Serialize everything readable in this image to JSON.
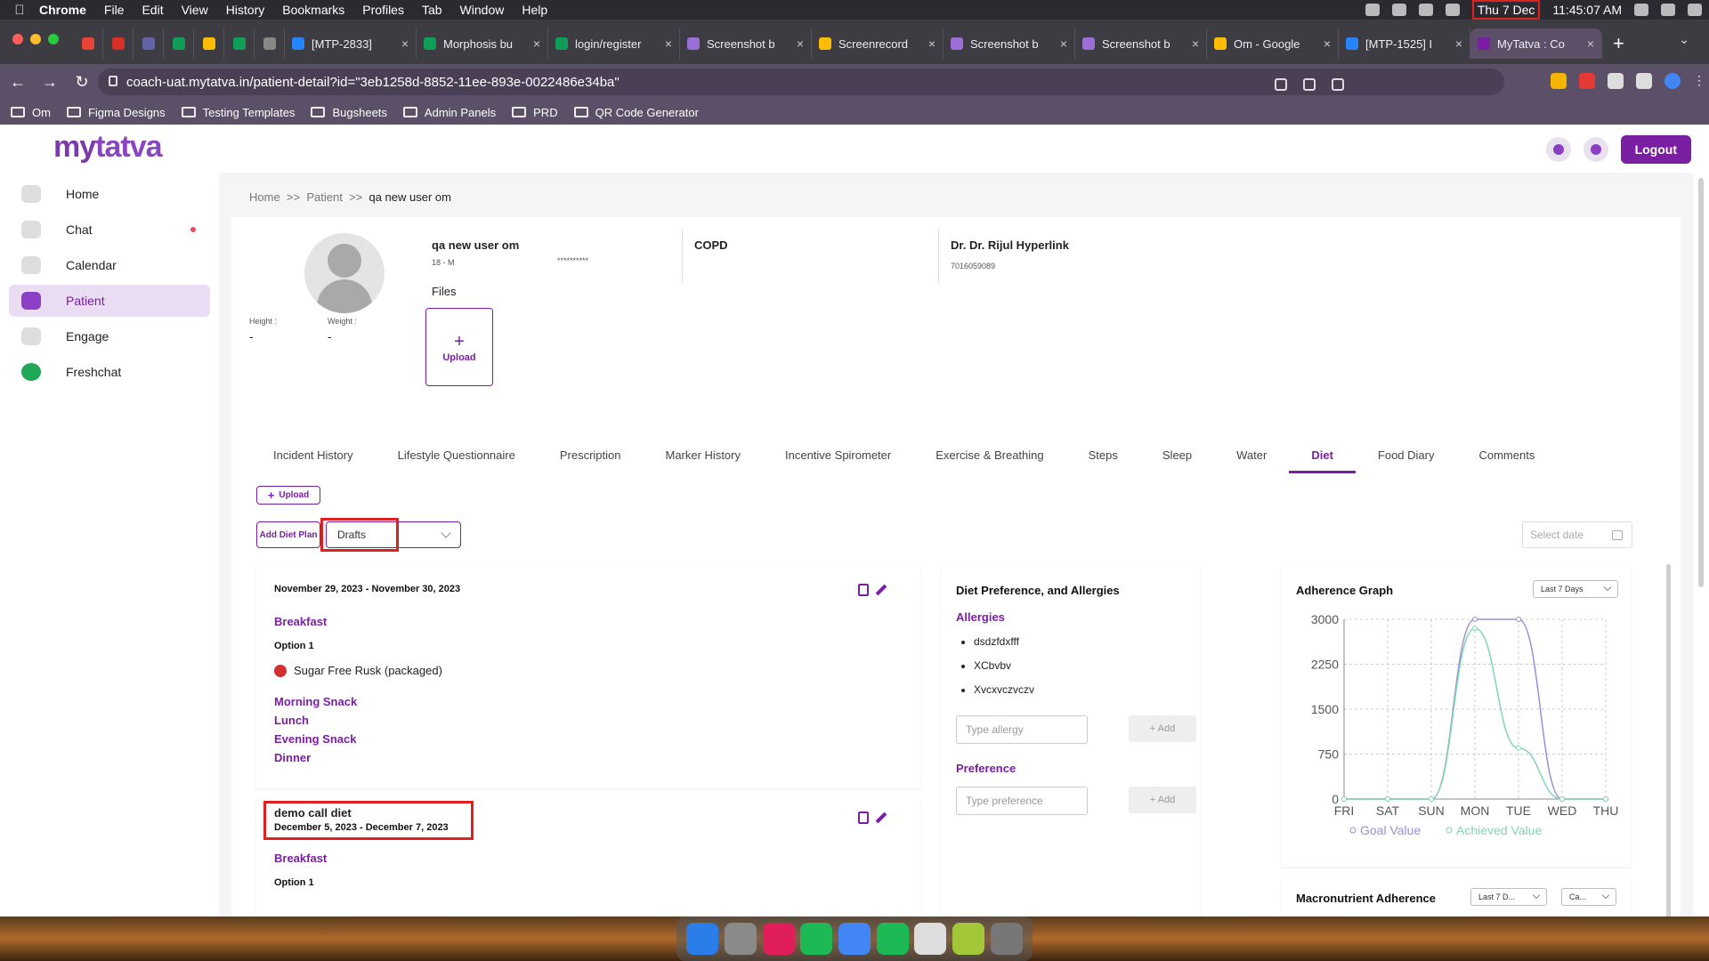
{
  "menubar": {
    "app": "Chrome",
    "items": [
      "File",
      "Edit",
      "View",
      "History",
      "Bookmarks",
      "Profiles",
      "Tab",
      "Window",
      "Help"
    ],
    "date": "Thu 7 Dec",
    "time": "11:45:07 AM"
  },
  "tabs": [
    {
      "label": "",
      "pinned": true,
      "color": "#e84335"
    },
    {
      "label": "",
      "pinned": true,
      "color": "#d93025"
    },
    {
      "label": "",
      "pinned": true,
      "color": "#6264a7"
    },
    {
      "label": "",
      "pinned": true,
      "color": "#0f9d58"
    },
    {
      "label": "",
      "pinned": true,
      "color": "#fbbc04"
    },
    {
      "label": "",
      "pinned": true,
      "color": "#0f9d58"
    },
    {
      "label": "",
      "pinned": true,
      "color": "#888888"
    },
    {
      "label": "[MTP-2833]",
      "color": "#2684ff"
    },
    {
      "label": "Morphosis bu",
      "color": "#0f9d58"
    },
    {
      "label": "login/register",
      "color": "#0f9d58"
    },
    {
      "label": "Screenshot b",
      "color": "#9c6fd6"
    },
    {
      "label": "Screenrecord",
      "color": "#fbbc04"
    },
    {
      "label": "Screenshot b",
      "color": "#9c6fd6"
    },
    {
      "label": "Screenshot b",
      "color": "#9c6fd6"
    },
    {
      "label": "Om - Google",
      "color": "#fbbc04"
    },
    {
      "label": "[MTP-1525] I",
      "color": "#2684ff"
    },
    {
      "label": "MyTatva : Co",
      "color": "#7a1fa2",
      "active": true
    }
  ],
  "url": "coach-uat.mytatva.in/patient-detail?id=\"3eb1258d-8852-11ee-893e-0022486e34ba\"",
  "bookmarks": [
    "Om",
    "Figma Designs",
    "Testing Templates",
    "Bugsheets",
    "Admin Panels",
    "PRD",
    "QR Code Generator"
  ],
  "brand": {
    "my": "my",
    "tatva": "tatva"
  },
  "header": {
    "logout": "Logout"
  },
  "sidebar": [
    {
      "label": "Home",
      "icon": "home-icon"
    },
    {
      "label": "Chat",
      "icon": "chat-icon",
      "dot": true
    },
    {
      "label": "Calendar",
      "icon": "calendar-icon"
    },
    {
      "label": "Patient",
      "icon": "patient-icon",
      "active": true
    },
    {
      "label": "Engage",
      "icon": "engage-icon"
    },
    {
      "label": "Freshchat",
      "icon": "freshchat-icon"
    }
  ],
  "breadcrumb": {
    "home": "Home",
    "sep": ">>",
    "patient": "Patient",
    "current": "qa new user om"
  },
  "patient": {
    "name": "qa new user om",
    "age_gender": "18 - M",
    "masked": "**********",
    "condition": "COPD",
    "doctor": "Dr. Dr. Rijul Hyperlink",
    "phone": "7016059089",
    "height_label": "Height :",
    "height": "-",
    "weight_label": "Weight :",
    "weight": "-",
    "files": "Files",
    "upload": "Upload"
  },
  "patient_tabs": [
    "Incident History",
    "Lifestyle Questionnaire",
    "Prescription",
    "Marker History",
    "Incentive Spirometer",
    "Exercise & Breathing",
    "Steps",
    "Sleep",
    "Water",
    "Diet",
    "Food Diary",
    "Comments"
  ],
  "active_tab": "Diet",
  "diet": {
    "upload": "Upload",
    "add_plan": "Add Diet Plan",
    "filter": "Drafts",
    "select_date": "Select date",
    "plans": [
      {
        "title": "",
        "dates": "November 29, 2023 - November 30, 2023",
        "meal1": "Breakfast",
        "option": "Option 1",
        "food": "Sugar Free Rusk (packaged)",
        "meals": [
          "Morning Snack",
          "Lunch",
          "Evening Snack",
          "Dinner"
        ]
      },
      {
        "title": "demo call diet",
        "dates": "December 5, 2023 - December 7, 2023",
        "meal1": "Breakfast",
        "option": "Option 1"
      }
    ]
  },
  "preferences": {
    "title": "Diet Preference, and Allergies",
    "allergies_title": "Allergies",
    "allergies": [
      "dsdzfdxfff",
      "XCbvbv",
      "Xvcxvczvczv"
    ],
    "allergy_placeholder": "Type allergy",
    "add": "+ Add",
    "preference_title": "Preference",
    "preference_placeholder": "Type preference"
  },
  "adherence": {
    "title": "Adherence Graph",
    "range": "Last 7 Days",
    "macro_title": "Macronutrient Adherence",
    "macro_range": "Last 7 D...",
    "macro_type": "Ca..."
  },
  "chart_data": {
    "type": "line",
    "categories": [
      "FRI",
      "SAT",
      "SUN",
      "MON",
      "TUE",
      "WED",
      "THU"
    ],
    "ylim": [
      0,
      3000
    ],
    "yticks": [
      0,
      750,
      1500,
      2250,
      3000
    ],
    "series": [
      {
        "name": "Goal Value",
        "color": "#9b8fd6",
        "values": [
          0,
          0,
          0,
          3000,
          3000,
          0,
          0
        ]
      },
      {
        "name": "Achieved Value",
        "color": "#7fd6b0",
        "values": [
          0,
          0,
          0,
          2850,
          850,
          0,
          0
        ]
      }
    ]
  },
  "dock": [
    "#2b7de9",
    "#8a8a8a",
    "#e01e5a",
    "#1db954",
    "#4285f4",
    "#1db954",
    "#dddddd",
    "#a4c639",
    "#777777"
  ]
}
